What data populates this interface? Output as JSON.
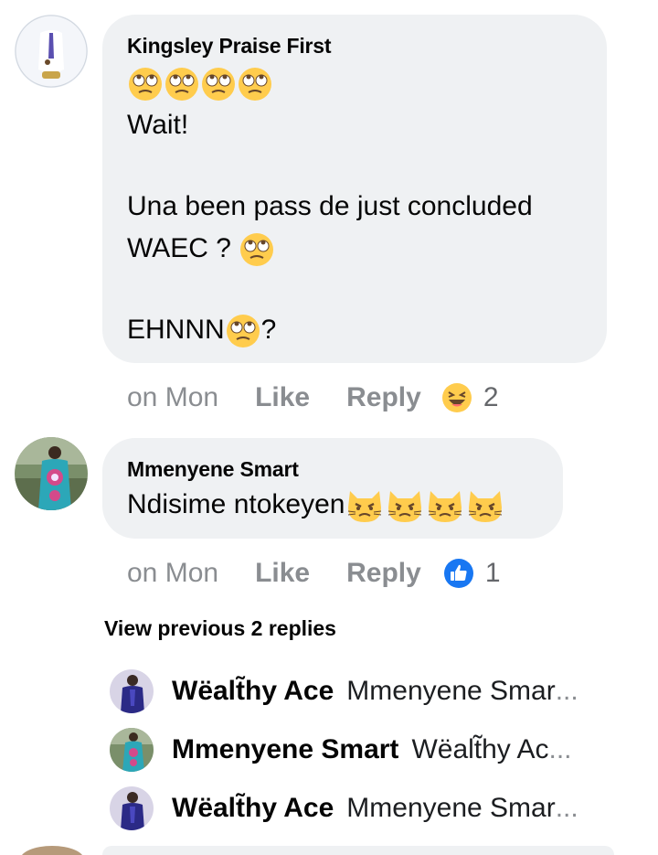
{
  "comments": [
    {
      "author": "Kingsley Praise First",
      "lines": [
        "Wait!",
        "",
        "Una been pass de just concluded",
        "WAEC ?",
        "",
        "EHNNN",
        "?"
      ],
      "time": "on Mon",
      "like_label": "Like",
      "reply_label": "Reply",
      "reaction_icon": "laughing-emoji-icon",
      "reaction_count": "2"
    },
    {
      "author": "Mmenyene Smart",
      "text": "Ndisime ntokeyen",
      "time": "on Mon",
      "like_label": "Like",
      "reply_label": "Reply",
      "reaction_icon": "thumbs-up-icon",
      "reaction_count": "1"
    }
  ],
  "view_previous_label": "View previous 2 replies",
  "replies": [
    {
      "author": "Wëalt̃hy Ace",
      "preview": "Mmenyene Smar",
      "ellipsis": "..."
    },
    {
      "author": "Mmenyene Smart",
      "preview": "Wëalt̃hy Ac",
      "ellipsis": "..."
    },
    {
      "author": "Wëalt̃hy Ace",
      "preview": "Mmenyene Smar",
      "ellipsis": "..."
    }
  ],
  "colors": {
    "bubble": "#eff1f3",
    "meta_text": "#8a8d91",
    "like_blue": "#1877f2",
    "emoji_yellow": "#ffcc4d"
  }
}
